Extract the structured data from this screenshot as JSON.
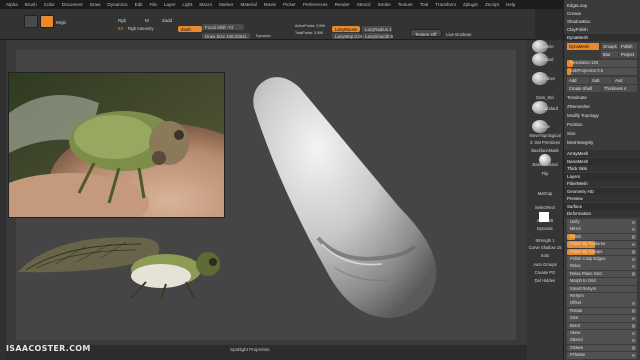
{
  "menu": [
    "Alpha",
    "Brush",
    "Color",
    "Document",
    "Draw",
    "Dynamics",
    "Edit",
    "File",
    "Layer",
    "Light",
    "Macro",
    "Marker",
    "Material",
    "Movie",
    "Picker",
    "Preferences",
    "Render",
    "Stencil",
    "Stroke",
    "Texture",
    "Tool",
    "Transform",
    "Zplugin",
    "Zscript",
    "Help"
  ],
  "toolbar": {
    "mrgb": "Mrgb",
    "rgb": "Rgb",
    "m": "M",
    "zadd": "Zadd",
    "zsub": "Zsub",
    "rgb_intensity": "Rgb Intensity",
    "z_intensity_value": "28",
    "z_intensity": "Z Intensity",
    "focal_shift": "Focal Shift -74",
    "draw_size": "Draw Size 108.20541",
    "dynamic": "Dynamic",
    "active_points": "ActivePoints: 3,996",
    "total_points": "TotalPoints: 3,996",
    "lazy_mouse": "LazyMouse",
    "lazy_radius": "LazyRadius 1",
    "lazy_step": "LazyStep 0.09",
    "lazy_smooth": "LazySmooth 9",
    "live_boolean": "Live Boolean",
    "texture_off": "Texture Off",
    "rgb_value": "94"
  },
  "tooltray": [
    "ZModeler",
    "Standard",
    "ClayTubes",
    "Dam_Std",
    "DamStandard",
    "Move",
    "MoveTopological",
    "3: SM Primitives",
    "BackfaceMask",
    "BasicMaterial",
    "Flip",
    "MatCap",
    "SelectRect",
    "Alpha 28",
    "Dynamic",
    "Strength 1",
    "Curve Shallow 15",
    "Solo",
    "Auto Groups",
    "Crease PG",
    "Del Hidden"
  ],
  "palette": {
    "top_items": [
      "EdgeLoop",
      "Crease",
      "ShadowBox",
      "ClayPolish"
    ],
    "dynamesh_head": "DynaMesh",
    "dynamesh_btn": "DynaMesh",
    "groups": "Groups",
    "polish": "Polish",
    "blur": "Blur",
    "project": "Project",
    "resolution": "Resolution 128",
    "subprojection": "SubProjection 0.6",
    "add": "Add",
    "sub": "Sub",
    "and": "And",
    "create_shell": "Create Shell",
    "thickness": "Thickness 4",
    "items2": [
      "Tessimate",
      "ZRemesher",
      "Modify Topology",
      "Position",
      "Size",
      "MeshIntegrity"
    ],
    "sections": [
      "ArrayMesh",
      "NanoMesh",
      "Thick Skin",
      "Layers",
      "FiberMesh",
      "Geometry HD",
      "Preview",
      "Surface",
      "Deformation"
    ],
    "deform": [
      "Unify",
      "Mirror",
      "Polish",
      "Polish By Features",
      "Polish By Groups",
      "Polish Crisp Edges",
      "Relax",
      "Relax Plane Grid",
      "Morph to Grid",
      "Smart ReSym",
      "ReSym",
      "Offset",
      "Rotate",
      "Size",
      "Bend",
      "Skew",
      "SBend",
      "SSkew",
      "FFlatten"
    ]
  },
  "bottom": {
    "spotlight": "Spotlight Projection"
  },
  "watermark": "ISAACOSTER.COM",
  "colors": {
    "accent": "#e8892b",
    "bg": "#2a2a2a"
  }
}
